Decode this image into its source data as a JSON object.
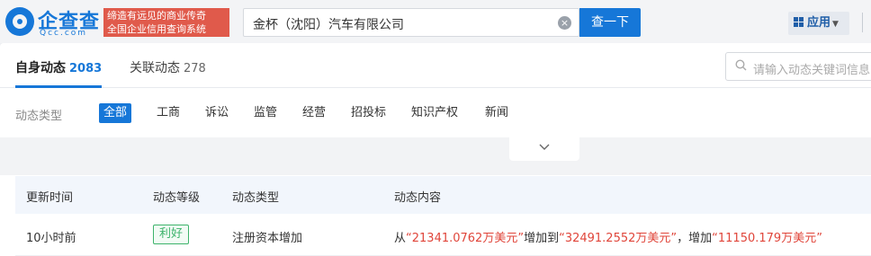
{
  "logo": {
    "name": "企查查",
    "domain": "Qcc.com"
  },
  "slogan": {
    "line1": "缔造有远见的商业传奇",
    "line2": "全国企业信用查询系统"
  },
  "search": {
    "value": "金杯（沈阳）汽车有限公司",
    "button_label": "查一下"
  },
  "app_menu": {
    "label": "应用"
  },
  "tabs": [
    {
      "label": "自身动态",
      "count": "2083"
    },
    {
      "label": "关联动态",
      "count": "278"
    }
  ],
  "keyword_search": {
    "placeholder": "请输入动态关键词信息"
  },
  "filter": {
    "label": "动态类型",
    "options": [
      "全部",
      "工商",
      "诉讼",
      "监管",
      "经营",
      "招投标",
      "知识产权",
      "新闻"
    ],
    "selected": "全部"
  },
  "table": {
    "headers": [
      "更新时间",
      "动态等级",
      "动态类型",
      "动态内容"
    ],
    "rows": [
      {
        "time": "10小时前",
        "level": "利好",
        "type": "注册资本增加",
        "content": {
          "prefix": "从",
          "from_value": "“21341.0762万美元”",
          "middle": "增加到",
          "to_value": "“32491.2552万美元”",
          "sep": "，",
          "increase_label": "增加",
          "increase_value": "“11150.179万美元”"
        }
      }
    ]
  },
  "colors": {
    "brand": "#1677d8",
    "positive": "#3db36b",
    "highlight": "#e0453a"
  }
}
